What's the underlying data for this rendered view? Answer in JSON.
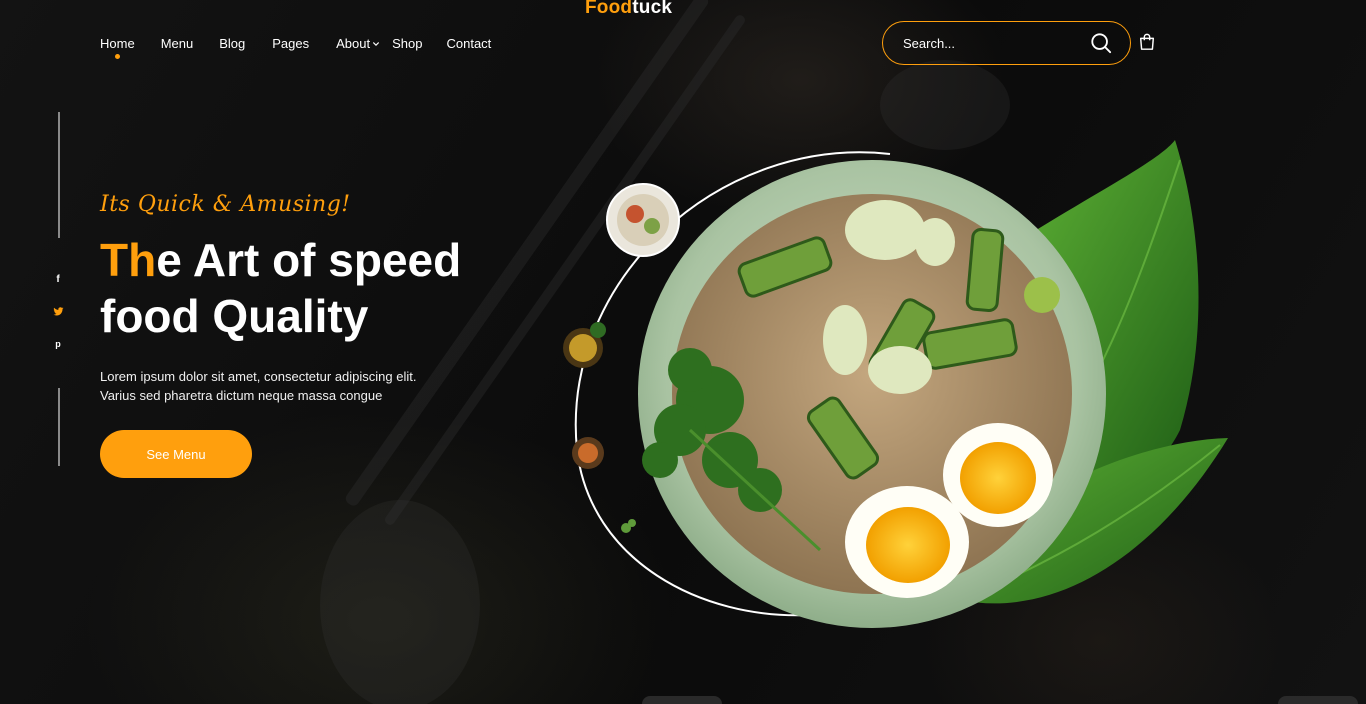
{
  "brand": {
    "part1": "Food",
    "part2": "tuck"
  },
  "nav": {
    "items": [
      {
        "label": "Home",
        "active": true
      },
      {
        "label": "Menu"
      },
      {
        "label": "Blog"
      },
      {
        "label": "Pages"
      },
      {
        "label": "About",
        "has_dropdown": true
      },
      {
        "label": "Shop"
      },
      {
        "label": "Contact"
      }
    ]
  },
  "search": {
    "placeholder": "Search..."
  },
  "socials": [
    {
      "name": "facebook",
      "glyph": "f",
      "color": "#ffffff"
    },
    {
      "name": "twitter",
      "glyph": "🐦",
      "color": "#FF9F0D"
    },
    {
      "name": "pinterest",
      "glyph": "p",
      "color": "#ffffff"
    }
  ],
  "hero": {
    "tagline": "Its Quick & Amusing!",
    "headline_accent": "Th",
    "headline_rest_line1": "e Art of speed",
    "headline_line2": "food Quality",
    "description_line1": "Lorem ipsum dolor sit amet, consectetur adipiscing elit.",
    "description_line2": "Varius sed pharetra dictum neque massa congue",
    "cta_label": "See Menu"
  },
  "colors": {
    "accent": "#FF9F0D",
    "background": "#0e0e0e"
  },
  "icons": {
    "search": "search-icon",
    "cart": "cart-icon",
    "dropdown": "chevron-down-icon"
  }
}
